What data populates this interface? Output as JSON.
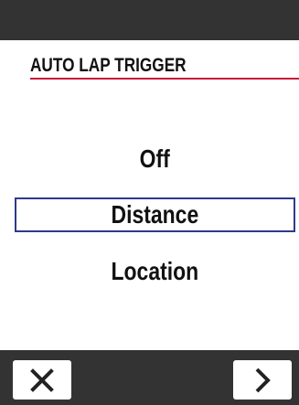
{
  "header": {
    "title": "AUTO LAP TRIGGER",
    "accent_color": "#c8173a"
  },
  "options": {
    "items": [
      {
        "label": "Off",
        "selected": false
      },
      {
        "label": "Distance",
        "selected": true
      },
      {
        "label": "Location",
        "selected": false
      }
    ],
    "selection_color": "#2f3a8a"
  },
  "footer": {
    "cancel_icon": "close-icon",
    "next_icon": "chevron-right-icon",
    "bar_color": "#333333"
  }
}
